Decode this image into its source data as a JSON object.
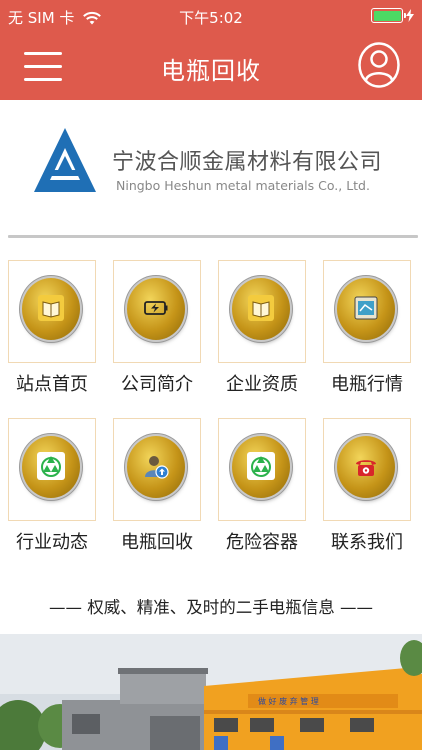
{
  "status_bar": {
    "carrier": "无 SIM 卡",
    "time": "下午5:02"
  },
  "nav": {
    "title": "电瓶回收",
    "menu_icon": "hamburger-menu-icon",
    "user_icon": "user-profile-icon"
  },
  "company": {
    "name_cn": "宁波合顺金属材料有限公司",
    "name_en": "Ningbo Heshun metal materials Co., Ltd."
  },
  "grid": {
    "items": [
      {
        "label": "站点首页",
        "icon": "book-icon"
      },
      {
        "label": "公司简介",
        "icon": "battery-icon"
      },
      {
        "label": "企业资质",
        "icon": "book-icon"
      },
      {
        "label": "电瓶行情",
        "icon": "calendar-note-icon"
      },
      {
        "label": "行业动态",
        "icon": "recycle-icon"
      },
      {
        "label": "电瓶回收",
        "icon": "user-upload-icon"
      },
      {
        "label": "危险容器",
        "icon": "recycle-icon"
      },
      {
        "label": "联系我们",
        "icon": "telephone-icon"
      }
    ]
  },
  "tagline": "—— 权威、精准、及时的二手电瓶信息 ——",
  "photo": {
    "sign_text": "做 好 废 弃 管 理"
  },
  "colors": {
    "header_red": "#de5a4c",
    "tile_border": "#f1d9b4",
    "coin_gold": "#c59418",
    "logo_blue": "#1f6fb5",
    "battery_green": "#4cd964"
  }
}
